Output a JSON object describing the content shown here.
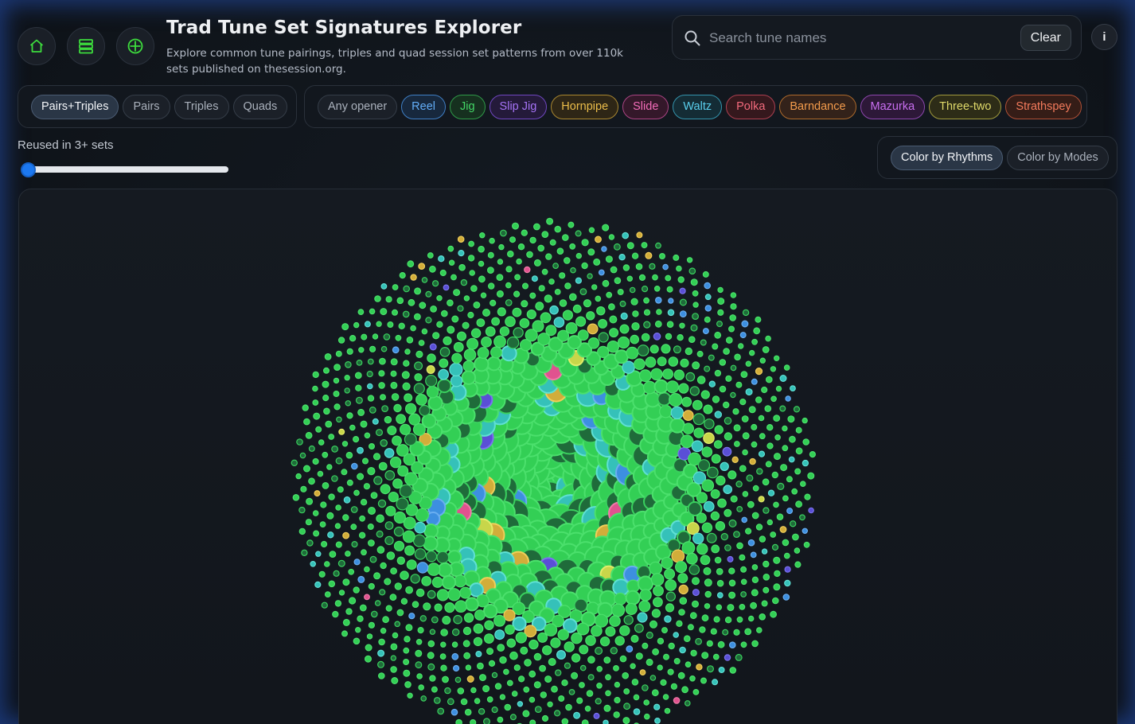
{
  "header": {
    "title": "Trad Tune Set Signatures Explorer",
    "subtitle": "Explore common tune pairings, triples and quad session set patterns from over 110k sets published on thesession.org.",
    "nav_icons": [
      "home-icon",
      "sets-stack-icon",
      "target-icon"
    ]
  },
  "search": {
    "placeholder": "Search tune names",
    "value": "",
    "clear_label": "Clear"
  },
  "info_label": "i",
  "set_size_filter": {
    "options": [
      "Pairs+Triples",
      "Pairs",
      "Triples",
      "Quads"
    ],
    "selected": "Pairs+Triples"
  },
  "opener_filter": {
    "options": [
      {
        "label": "Any opener",
        "color": "#aab1bc"
      },
      {
        "label": "Reel",
        "color": "#4aa3ff"
      },
      {
        "label": "Jig",
        "color": "#33d15b"
      },
      {
        "label": "Slip Jig",
        "color": "#9b5cf5"
      },
      {
        "label": "Hornpipe",
        "color": "#e8b63a"
      },
      {
        "label": "Slide",
        "color": "#f05bb0"
      },
      {
        "label": "Waltz",
        "color": "#46c8e8"
      },
      {
        "label": "Polka",
        "color": "#f05a6e"
      },
      {
        "label": "Barndance",
        "color": "#f2923a"
      },
      {
        "label": "Mazurka",
        "color": "#c05ee8"
      },
      {
        "label": "Three-two",
        "color": "#d9d25a"
      },
      {
        "label": "Strathspey",
        "color": "#f26b4a"
      }
    ],
    "selected": "Any opener"
  },
  "reuse_slider": {
    "label": "Reused in 3+ sets",
    "min": 3,
    "value": 3
  },
  "color_mode": {
    "options": [
      "Color by Rhythms",
      "Color by Modes"
    ],
    "selected": "Color by Rhythms"
  },
  "bubble_palette": {
    "jig": "#33cf55",
    "jig_dark": "#1f6b3a",
    "reel": "#3d8fe0",
    "waltz": "#35c1b9",
    "hornpipe": "#d2ad3a",
    "slip_jig": "#5a4fd6",
    "slide": "#e0528f",
    "three_two": "#c8d64a"
  }
}
